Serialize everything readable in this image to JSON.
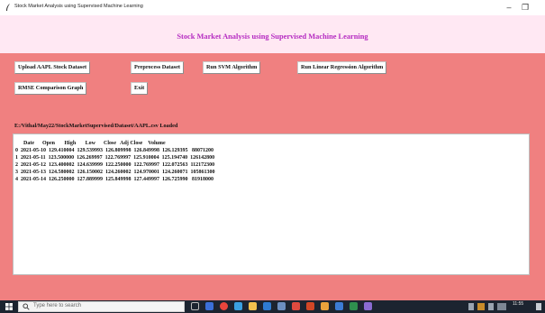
{
  "window": {
    "title": "Stock Market Analysis using Supervised Machine Learning",
    "minimize": "–",
    "maximize": "❐"
  },
  "app": {
    "heading": "Stock Market Analysis using Supervised Machine Learning",
    "background_color": "#f08080",
    "header_color": "#ffe8f3",
    "heading_color": "#b52cc1"
  },
  "buttons": {
    "upload": "Upload AAPL Stock Dataset",
    "preprocess": "Preprocess Dataset",
    "svm": "Run SVM Algorithm",
    "linear_regression": "Run Linear Regression Algorithm",
    "rmse": "RMSE Comparison Graph",
    "exit": "Exit"
  },
  "status": "E:/Vithal/May22/StockMarketSupervised/Dataset/AAPL.csv Loaded",
  "output": {
    "header": "      Date      Open       High       Low      Close   Adj Close    Volume",
    "rows": [
      "0  2021-05-10  129.410004  129.539993  126.809998  126.849998  126.129395   88071200",
      "1  2021-05-11  123.500000  126.269997  122.769997  125.910004  125.194740  126142800",
      "2  2021-05-12  123.400002  124.639999  122.250000  122.769997  122.072563  112172300",
      "3  2021-05-13  124.580002  126.150002  124.260002  124.970001  124.260071  105861300",
      "4  2021-05-14  126.250000  127.889999  125.849998  127.449997  126.725990   81918000"
    ]
  },
  "taskbar": {
    "search_placeholder": "Type here to search",
    "time": "11:55",
    "icons": [
      "task-view-icon",
      "chrome-icon",
      "folder-icon",
      "edge-icon",
      "mail-icon",
      "store-icon",
      "security-icon",
      "tool-icon",
      "powerpoint-icon",
      "office-icon",
      "excel-icon",
      "word-icon",
      "app-icon"
    ]
  }
}
